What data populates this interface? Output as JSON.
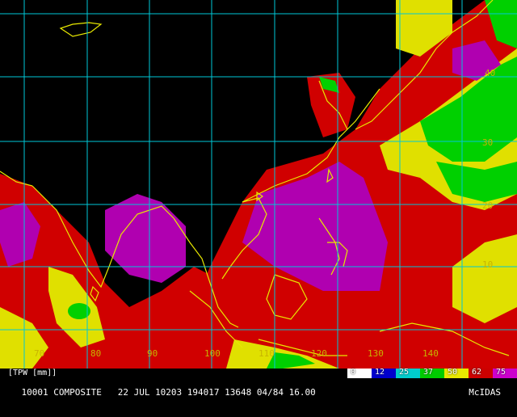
{
  "product_label": "[TPW [mm]]",
  "status_line": "10001 COMPOSITE   22 JUL 10203 194017 13648 04/84 16.00",
  "software": "McIDAS",
  "latitude_labels": [
    "40",
    "30",
    "20",
    "10"
  ],
  "longitude_labels": [
    "70",
    "80",
    "90",
    "100",
    "110",
    "120",
    "130",
    "140"
  ],
  "scale": {
    "labels": [
      "0",
      "12",
      "25",
      "37",
      "50",
      "62",
      "75"
    ],
    "colors": [
      "#ffffff",
      "#0000cc",
      "#00cccc",
      "#00cc00",
      "#e8e800",
      "#cc0000",
      "#cc00cc"
    ]
  },
  "colors": {
    "land_outline": "#e8e800",
    "grid": "#00c8d8",
    "water_vapor_high": "#cc00cc",
    "water_vapor_med_high": "#d00000",
    "water_vapor_med": "#e0e000",
    "water_vapor_low": "#00d000",
    "background": "#000000"
  }
}
